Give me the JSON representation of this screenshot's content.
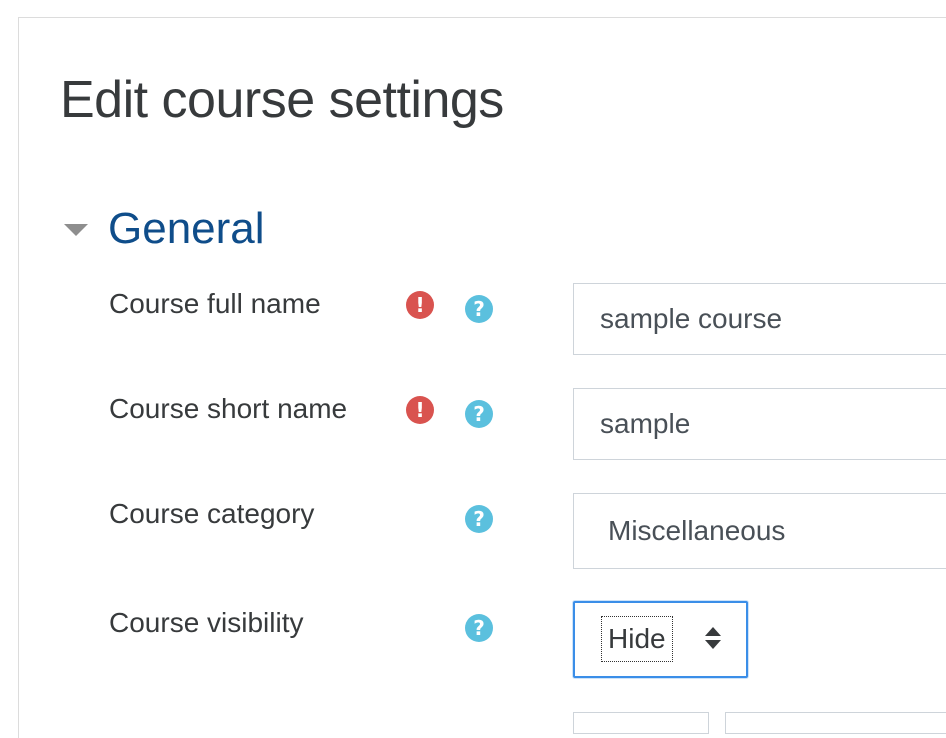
{
  "page": {
    "title": "Edit course settings"
  },
  "section": {
    "title": "General"
  },
  "fields": {
    "fullname": {
      "label": "Course full name",
      "required_icon": "exclamation-circle-icon",
      "help_icon": "question-circle-icon",
      "value": "sample course"
    },
    "shortname": {
      "label": "Course short name",
      "required_icon": "exclamation-circle-icon",
      "help_icon": "question-circle-icon",
      "value": "sample"
    },
    "category": {
      "label": "Course category",
      "help_icon": "question-circle-icon",
      "value": "Miscellaneous"
    },
    "visibility": {
      "label": "Course visibility",
      "help_icon": "question-circle-icon",
      "selected": "Hide"
    }
  },
  "icons": {
    "required_glyph": "!",
    "help_glyph": "?"
  },
  "colors": {
    "section_title": "#0f4d8a",
    "required": "#d9534f",
    "help": "#5bc0de",
    "focus_border": "#3b8ee8"
  }
}
